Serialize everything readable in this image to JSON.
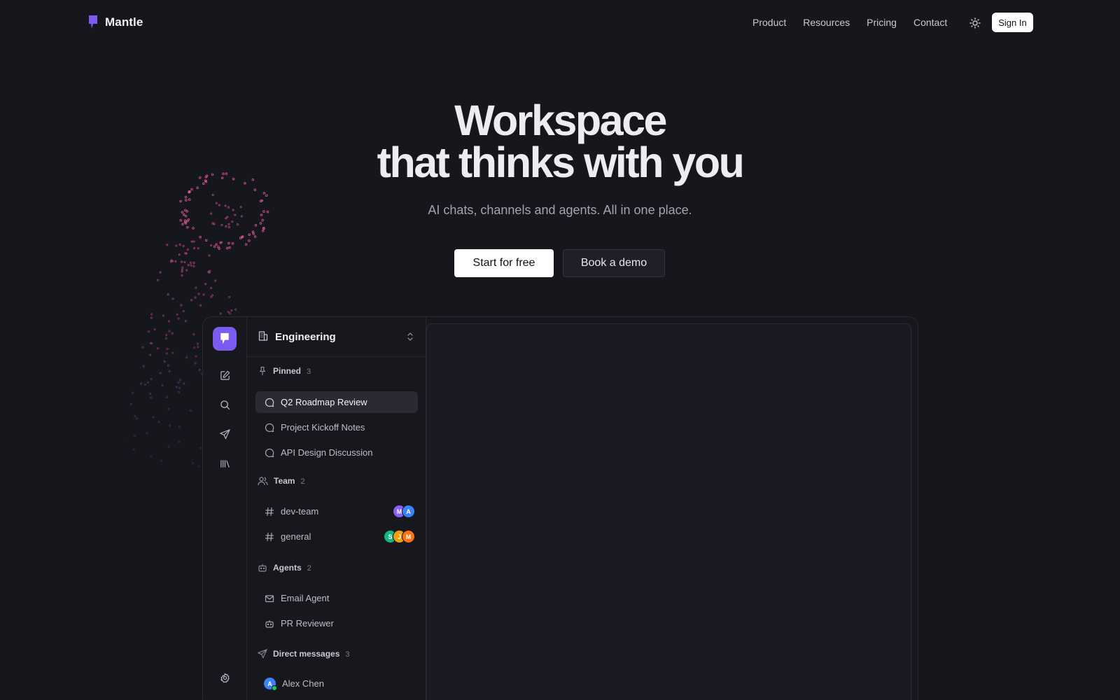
{
  "brand": {
    "name": "Mantle",
    "accent": "#7c5cf0"
  },
  "nav": {
    "links": [
      "Product",
      "Resources",
      "Pricing",
      "Contact"
    ],
    "theme_icon": "sun-icon",
    "signin_label": "Sign In"
  },
  "hero": {
    "title_line1": "Workspace",
    "title_line2": "that thinks with you",
    "subtitle": "AI chats, channels and agents. All in one place.",
    "primary_cta": "Start for free",
    "secondary_cta": "Book a demo"
  },
  "app": {
    "workspace": "Engineering",
    "rail_icons": [
      "compose-icon",
      "search-icon",
      "send-icon",
      "library-icon",
      "settings-icon"
    ],
    "sections": {
      "pinned": {
        "label": "Pinned",
        "count": "3",
        "items": [
          "Q2 Roadmap Review",
          "Project Kickoff Notes",
          "API Design Discussion"
        ]
      },
      "team": {
        "label": "Team",
        "count": "2",
        "channels": [
          {
            "name": "dev-team",
            "avatars": [
              {
                "initial": "M",
                "color": "#8b5cf6"
              },
              {
                "initial": "A",
                "color": "#3b82f6"
              }
            ]
          },
          {
            "name": "general",
            "avatars": [
              {
                "initial": "S",
                "color": "#10b981"
              },
              {
                "initial": "J",
                "color": "#f59e0b"
              },
              {
                "initial": "M",
                "color": "#f97316"
              }
            ]
          }
        ]
      },
      "agents": {
        "label": "Agents",
        "count": "2",
        "items": [
          "Email Agent",
          "PR Reviewer"
        ]
      },
      "dms": {
        "label": "Direct messages",
        "count": "3",
        "items": [
          {
            "name": "Alex Chen",
            "initial": "A",
            "color": "#3b82f6",
            "online": true
          }
        ]
      }
    }
  }
}
